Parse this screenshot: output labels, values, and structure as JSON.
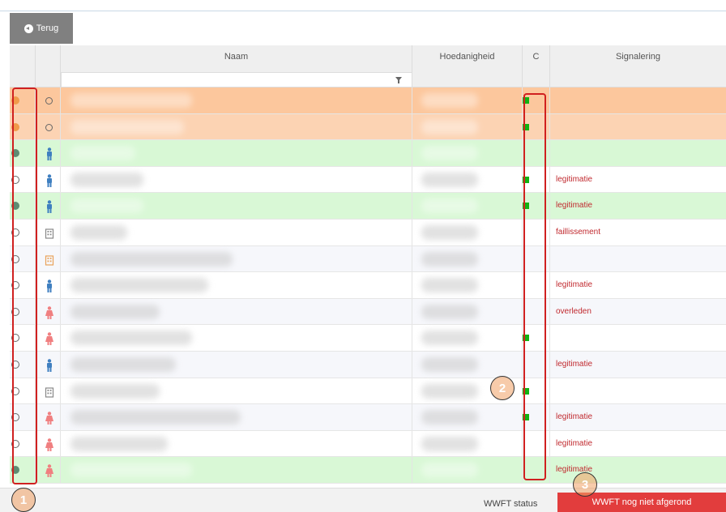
{
  "toolbar": {
    "back_label": "Terug"
  },
  "table": {
    "columns": [
      "Naam",
      "Hoedanigheid",
      "C",
      "Signalering"
    ],
    "rows": [
      {
        "bg": "#fcc79d",
        "status": "orange",
        "type": "ring",
        "check": true,
        "signal": ""
      },
      {
        "bg": "#fcd3b3",
        "status": "orange",
        "type": "ring",
        "check": true,
        "signal": ""
      },
      {
        "bg": "#d8f8d5",
        "status": "green",
        "type": "male",
        "check": false,
        "signal": ""
      },
      {
        "bg": "#ffffff",
        "status": "hollow",
        "type": "male",
        "check": true,
        "signal": "legitimatie"
      },
      {
        "bg": "#d9f8d6",
        "status": "green",
        "type": "male",
        "check": true,
        "signal": "legitimatie"
      },
      {
        "bg": "#ffffff",
        "status": "hollow",
        "type": "building",
        "check": false,
        "signal": "faillissement"
      },
      {
        "bg": "#f6f7fb",
        "status": "hollow",
        "type": "building-orange",
        "check": false,
        "signal": ""
      },
      {
        "bg": "#ffffff",
        "status": "hollow",
        "type": "male",
        "check": false,
        "signal": "legitimatie"
      },
      {
        "bg": "#f6f7fb",
        "status": "hollow",
        "type": "female",
        "check": false,
        "signal": "overleden"
      },
      {
        "bg": "#ffffff",
        "status": "hollow",
        "type": "female",
        "check": true,
        "signal": ""
      },
      {
        "bg": "#f6f7fb",
        "status": "hollow",
        "type": "male",
        "check": false,
        "signal": "legitimatie"
      },
      {
        "bg": "#ffffff",
        "status": "hollow",
        "type": "building",
        "check": true,
        "signal": ""
      },
      {
        "bg": "#f6f7fb",
        "status": "hollow",
        "type": "female",
        "check": true,
        "signal": "legitimatie"
      },
      {
        "bg": "#ffffff",
        "status": "hollow",
        "type": "female",
        "check": false,
        "signal": "legitimatie"
      },
      {
        "bg": "#d9f8d6",
        "status": "green",
        "type": "female",
        "check": false,
        "signal": "legitimatie"
      }
    ]
  },
  "footer": {
    "wwft_label": "WWFT status",
    "wwft_status": "WWFT nog niet afgerond"
  },
  "annotations": [
    "1",
    "2",
    "3"
  ],
  "colors": {
    "accent_red": "#e23d3d",
    "highlight_red": "#d02020",
    "check_green": "#12b312",
    "male_blue": "#3f7fc0",
    "female_pink": "#f07f80"
  }
}
